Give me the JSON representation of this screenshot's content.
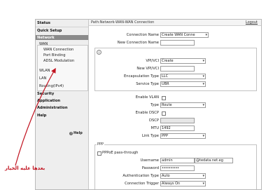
{
  "sidebar": {
    "items": [
      {
        "label": "Status"
      },
      {
        "label": "Quick Setup"
      },
      {
        "label": "Network"
      },
      {
        "label": "WAN"
      },
      {
        "label": "WAN Connection"
      },
      {
        "label": "Port Binding"
      },
      {
        "label": "ADSL Modulation"
      },
      {
        "label": "WLAN"
      },
      {
        "label": "LAN"
      },
      {
        "label": "Routing(IPv4)"
      },
      {
        "label": "Security"
      },
      {
        "label": "Application"
      },
      {
        "label": "Administration"
      },
      {
        "label": "Help"
      }
    ],
    "help_label": "Help"
  },
  "header": {
    "breadcrumb": "Path:Network-WAN-WAN Connection",
    "logout": "Logout"
  },
  "form": {
    "connection_name_label": "Connection Name",
    "connection_name_value": "Create WAN Conne",
    "new_connection_name_label": "New Connection Name",
    "new_connection_name_value": "",
    "vpi_vci_label": "VPI/VCI",
    "vpi_vci_value": "Create",
    "new_vpi_vci_label": "New VPI/VCI",
    "new_vpi_vci_value": "",
    "encapsulation_label": "Encapsulation Type",
    "encapsulation_value": "LLC",
    "service_type_label": "Service Type",
    "service_type_value": "UBR",
    "enable_vlan_label": "Enable VLAN",
    "type_label": "Type",
    "type_value": "Route",
    "enable_dscp_label": "Enable DSCP",
    "dscp_label": "DSCP",
    "dscp_value": "",
    "mtu_label": "MTU",
    "mtu_value": "1492",
    "link_type_label": "Link Type",
    "link_type_value": "PPP"
  },
  "ppp": {
    "title": "PPP",
    "passthrough_label": "PPPoE pass-through",
    "username_label": "Username",
    "username_value": "admin",
    "username_suffix": "@tedata.net.eg",
    "password_label": "Password",
    "password_value": "••••••••••",
    "auth_type_label": "Authentication Type",
    "auth_type_value": "Auto",
    "trigger_label": "Connection Trigger",
    "trigger_value": "Always On"
  },
  "annotation": {
    "text": "بعدها عليه الخيار",
    "color": "#c1121f"
  }
}
